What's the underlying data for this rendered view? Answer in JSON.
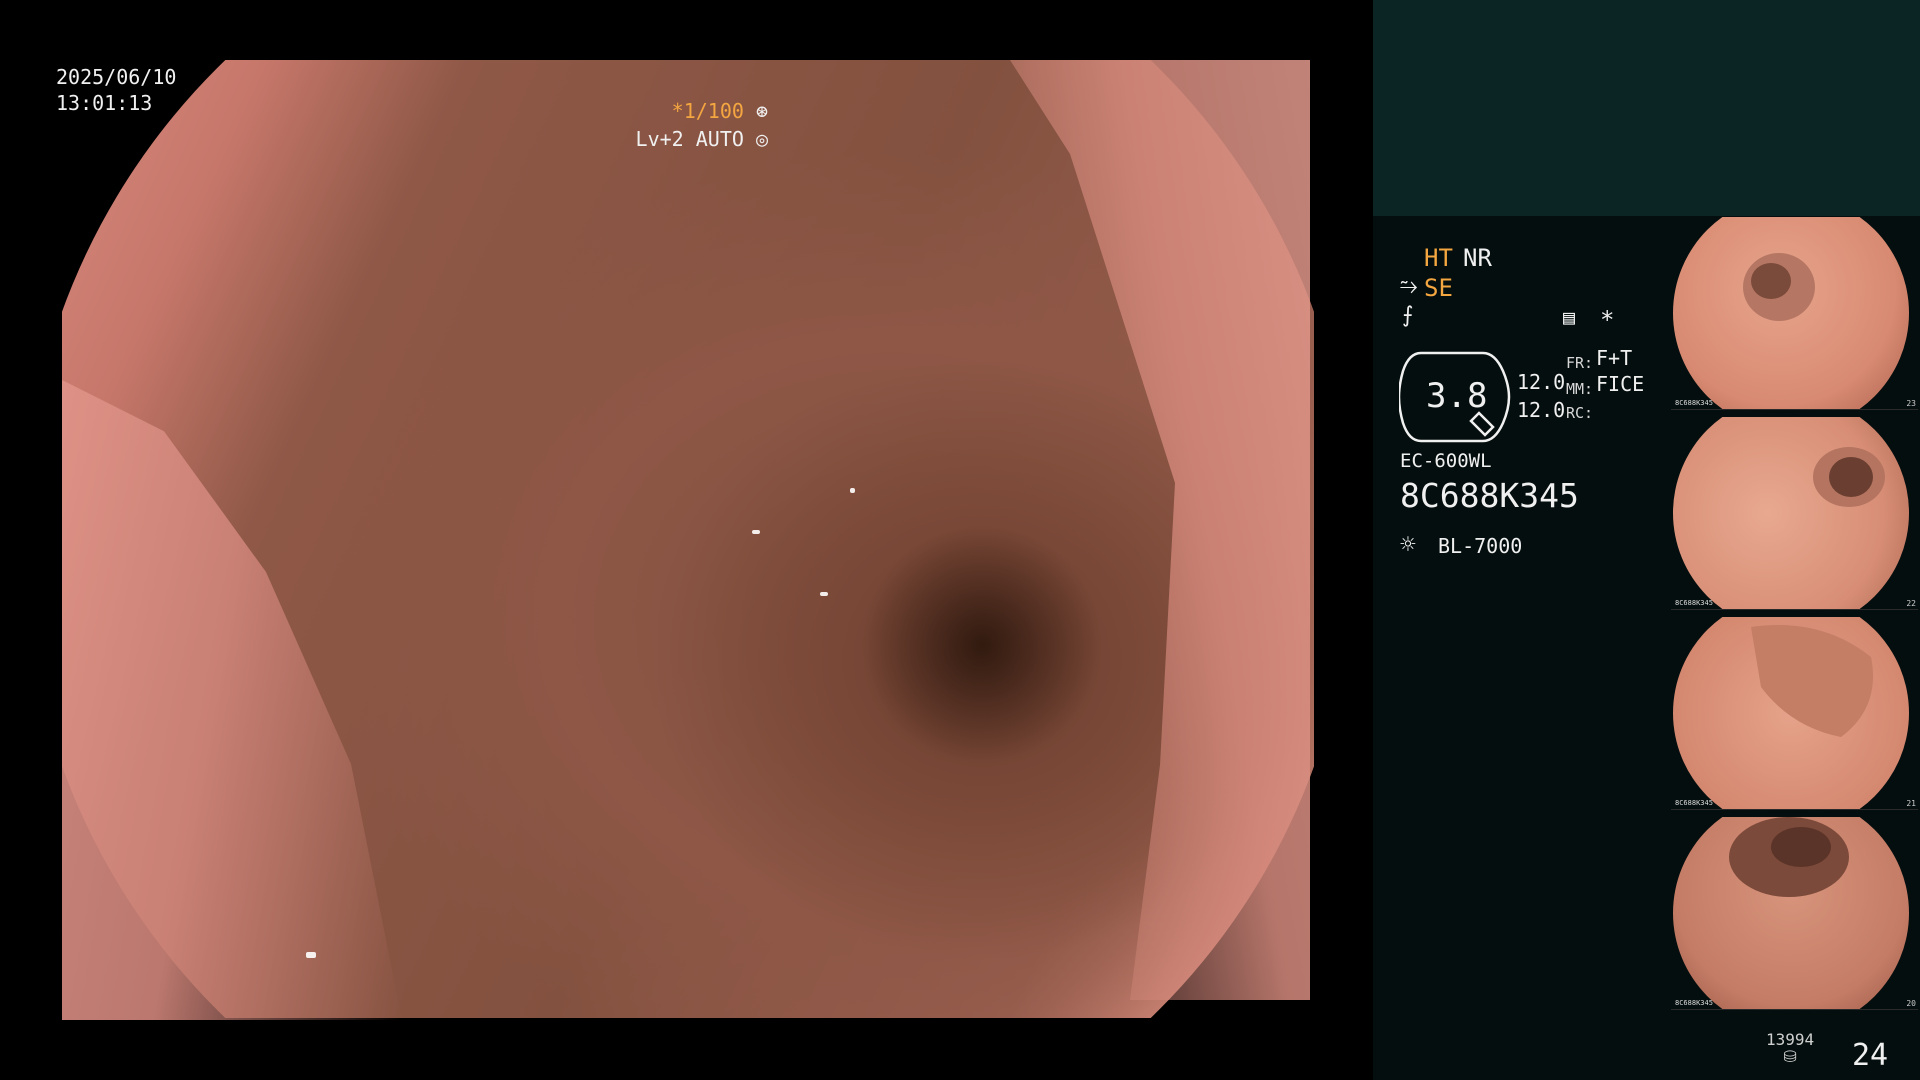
{
  "osd": {
    "date": "2025/06/10",
    "time": "13:01:13",
    "shutter": "*1/100",
    "level": "Lv+2 AUTO"
  },
  "panel": {
    "ht": "HT",
    "nr": "NR",
    "se": "SE",
    "fr_label": "FR:",
    "fr_value": "F+T",
    "mm_label": "MM:",
    "mm_value": "FICE",
    "rc_label": "RC:",
    "zoom": "3.8",
    "value_top": "12.0",
    "value_bottom": "12.0",
    "scope_model": "EC-600WL",
    "serial": "8C688K345",
    "light_source": "BL-7000"
  },
  "thumbnails": [
    {
      "num": "23",
      "id": "8C688K345"
    },
    {
      "num": "22",
      "id": "8C688K345"
    },
    {
      "num": "21",
      "id": "8C688K345"
    },
    {
      "num": "20",
      "id": "8C688K345"
    }
  ],
  "footer": {
    "storage_count": "13994",
    "page": "24"
  },
  "colors": {
    "accent": "#f4a640",
    "panel_top": "#0b2424",
    "panel_bg": "#050e0e"
  }
}
